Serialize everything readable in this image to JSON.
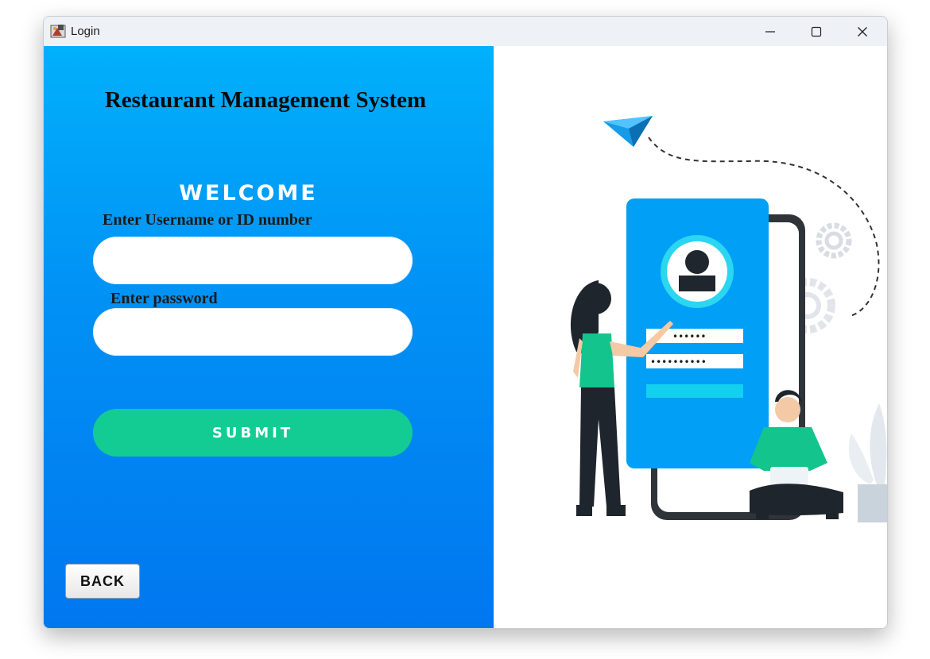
{
  "window": {
    "title": "Login",
    "controls": [
      "minimize",
      "maximize",
      "close"
    ]
  },
  "form": {
    "app_title": "Restaurant Management System",
    "welcome": "WELCOME",
    "username_label": "Enter Username or ID number",
    "username_value": "",
    "password_label": "Enter password",
    "password_value": "",
    "submit_label": "SUBMIT",
    "back_label": "BACK"
  },
  "colors": {
    "panel_top": "#01b0fb",
    "panel_bottom": "#0177ef",
    "submit": "#13cc94",
    "illustration_accent": "#019ff6",
    "illustration_green": "#13c48d"
  },
  "illustration": {
    "icons": [
      "paper-plane-icon",
      "phone-icon",
      "user-avatar-icon",
      "gear-icon",
      "plant-icon"
    ],
    "masked_username": "••••••",
    "masked_password": "••••••••••"
  }
}
